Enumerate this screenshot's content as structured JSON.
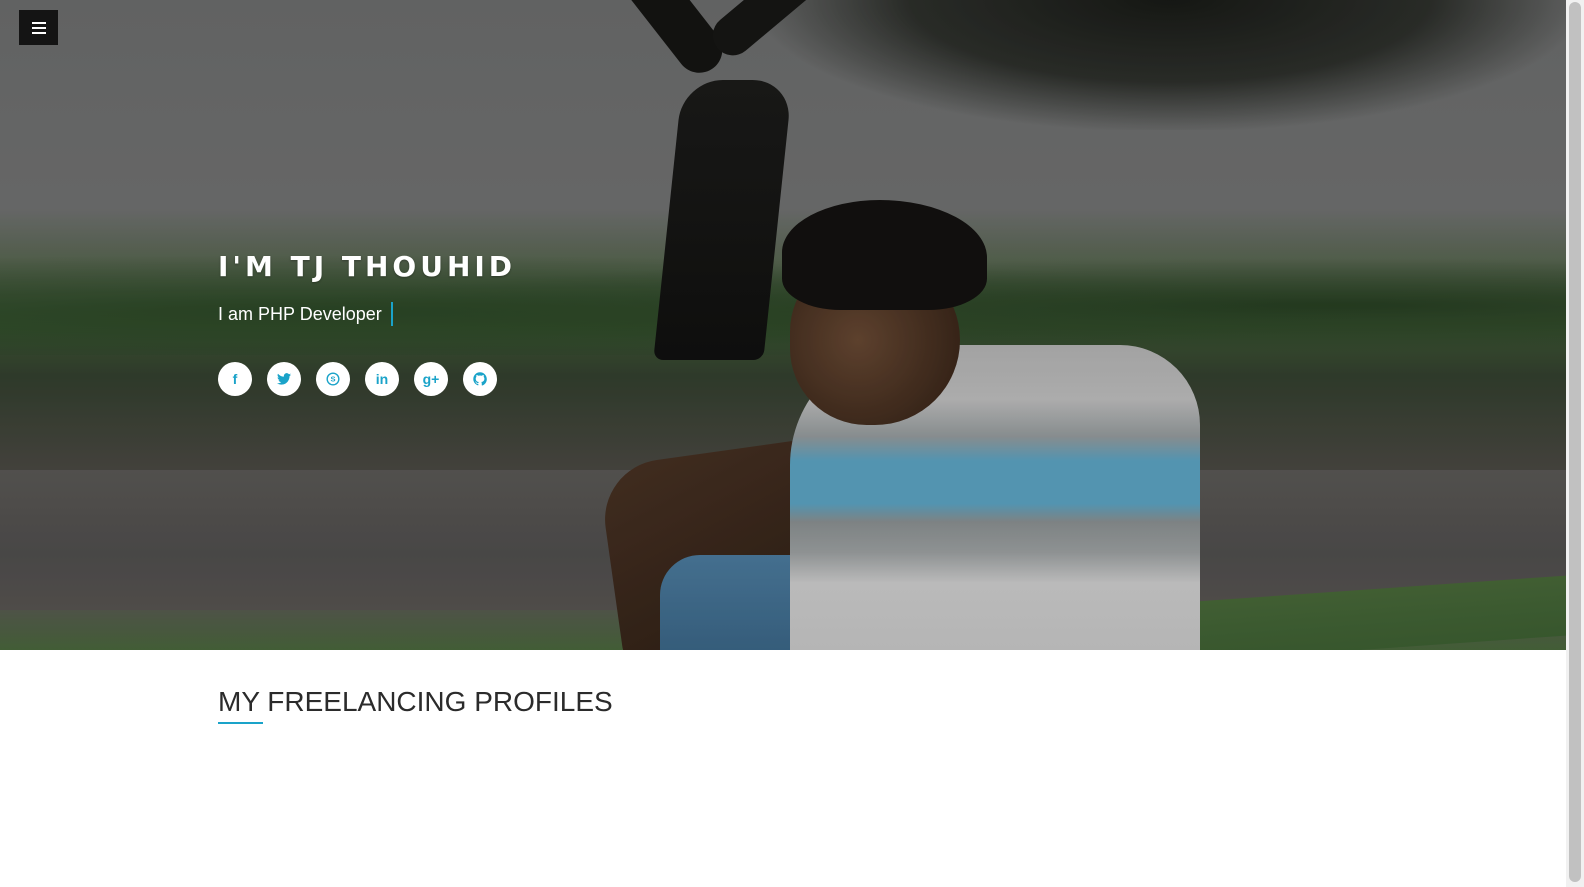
{
  "hero": {
    "title": "I'M TJ THOUHID",
    "subtitle": "I am PHP Developer"
  },
  "menu": {
    "icon": "hamburger-menu-icon"
  },
  "social": [
    {
      "name": "facebook",
      "icon": "facebook-icon",
      "glyph": "f"
    },
    {
      "name": "twitter",
      "icon": "twitter-icon"
    },
    {
      "name": "skype",
      "icon": "skype-icon"
    },
    {
      "name": "linkedin",
      "icon": "linkedin-icon",
      "glyph": "in"
    },
    {
      "name": "google-plus",
      "icon": "google-plus-icon",
      "glyph": "g+"
    },
    {
      "name": "github",
      "icon": "github-icon"
    }
  ],
  "section": {
    "title": "MY FREELANCING PROFILES"
  },
  "colors": {
    "accent": "#1aa3c9",
    "menu_bg": "#141414",
    "heading": "#2b2b2b"
  }
}
